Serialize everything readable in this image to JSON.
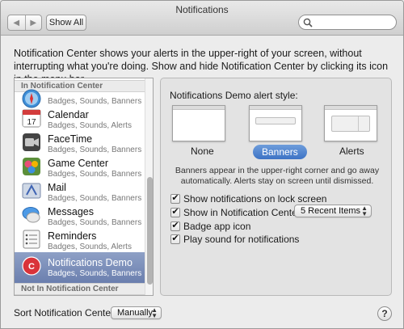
{
  "window": {
    "title": "Notifications",
    "show_all_label": "Show All",
    "back_icon": "chevron-left-icon",
    "forward_icon": "chevron-right-icon",
    "search": {
      "value": "",
      "placeholder": ""
    }
  },
  "description": "Notification Center shows your alerts in the upper-right of your screen, without interrupting what you're doing. Show and hide Notification Center by clicking its icon in the menu bar.",
  "sidebar": {
    "section_in": "In Notification Center",
    "section_out": "Not In Notification Center",
    "items": [
      {
        "name": "",
        "subtitle": "Badges, Sounds, Banners",
        "icon": "safari-icon",
        "color": "#3f8fd8"
      },
      {
        "name": "Calendar",
        "subtitle": "Badges, Sounds, Alerts",
        "icon": "calendar-icon",
        "color": "#d33c3c"
      },
      {
        "name": "FaceTime",
        "subtitle": "Badges, Sounds, Banners",
        "icon": "facetime-icon",
        "color": "#555555"
      },
      {
        "name": "Game Center",
        "subtitle": "Badges, Sounds, Banners",
        "icon": "game-center-icon",
        "color": "#6aa63c"
      },
      {
        "name": "Mail",
        "subtitle": "Badges, Sounds, Banners",
        "icon": "mail-icon",
        "color": "#4f7fd2"
      },
      {
        "name": "Messages",
        "subtitle": "Badges, Sounds, Banners",
        "icon": "messages-icon",
        "color": "#4d9ae6"
      },
      {
        "name": "Reminders",
        "subtitle": "Badges, Sounds, Alerts",
        "icon": "reminders-icon",
        "color": "#e9e9e9"
      },
      {
        "name": "Notifications Demo",
        "subtitle": "Badges, Sounds, Banners",
        "icon": "notifications-demo-icon",
        "color": "#d9333a",
        "selected": true
      }
    ]
  },
  "alert_style": {
    "title": "Notifications Demo alert style:",
    "options": [
      "None",
      "Banners",
      "Alerts"
    ],
    "selected": "Banners",
    "help_text": "Banners appear in the upper-right corner and go away automatically. Alerts stay on screen until dismissed."
  },
  "options": {
    "lock_screen": {
      "label": "Show notifications on lock screen",
      "checked": true
    },
    "show_in_nc": {
      "label": "Show in Notification Center:",
      "checked": true,
      "value": "5 Recent Items"
    },
    "badge": {
      "label": "Badge app icon",
      "checked": true
    },
    "sound": {
      "label": "Play sound for notifications",
      "checked": true
    }
  },
  "sort": {
    "label": "Sort Notification Center:",
    "value": "Manually"
  },
  "help_button_label": "?",
  "accent_color": "#3d73c5",
  "selection_color": "#7286b5"
}
